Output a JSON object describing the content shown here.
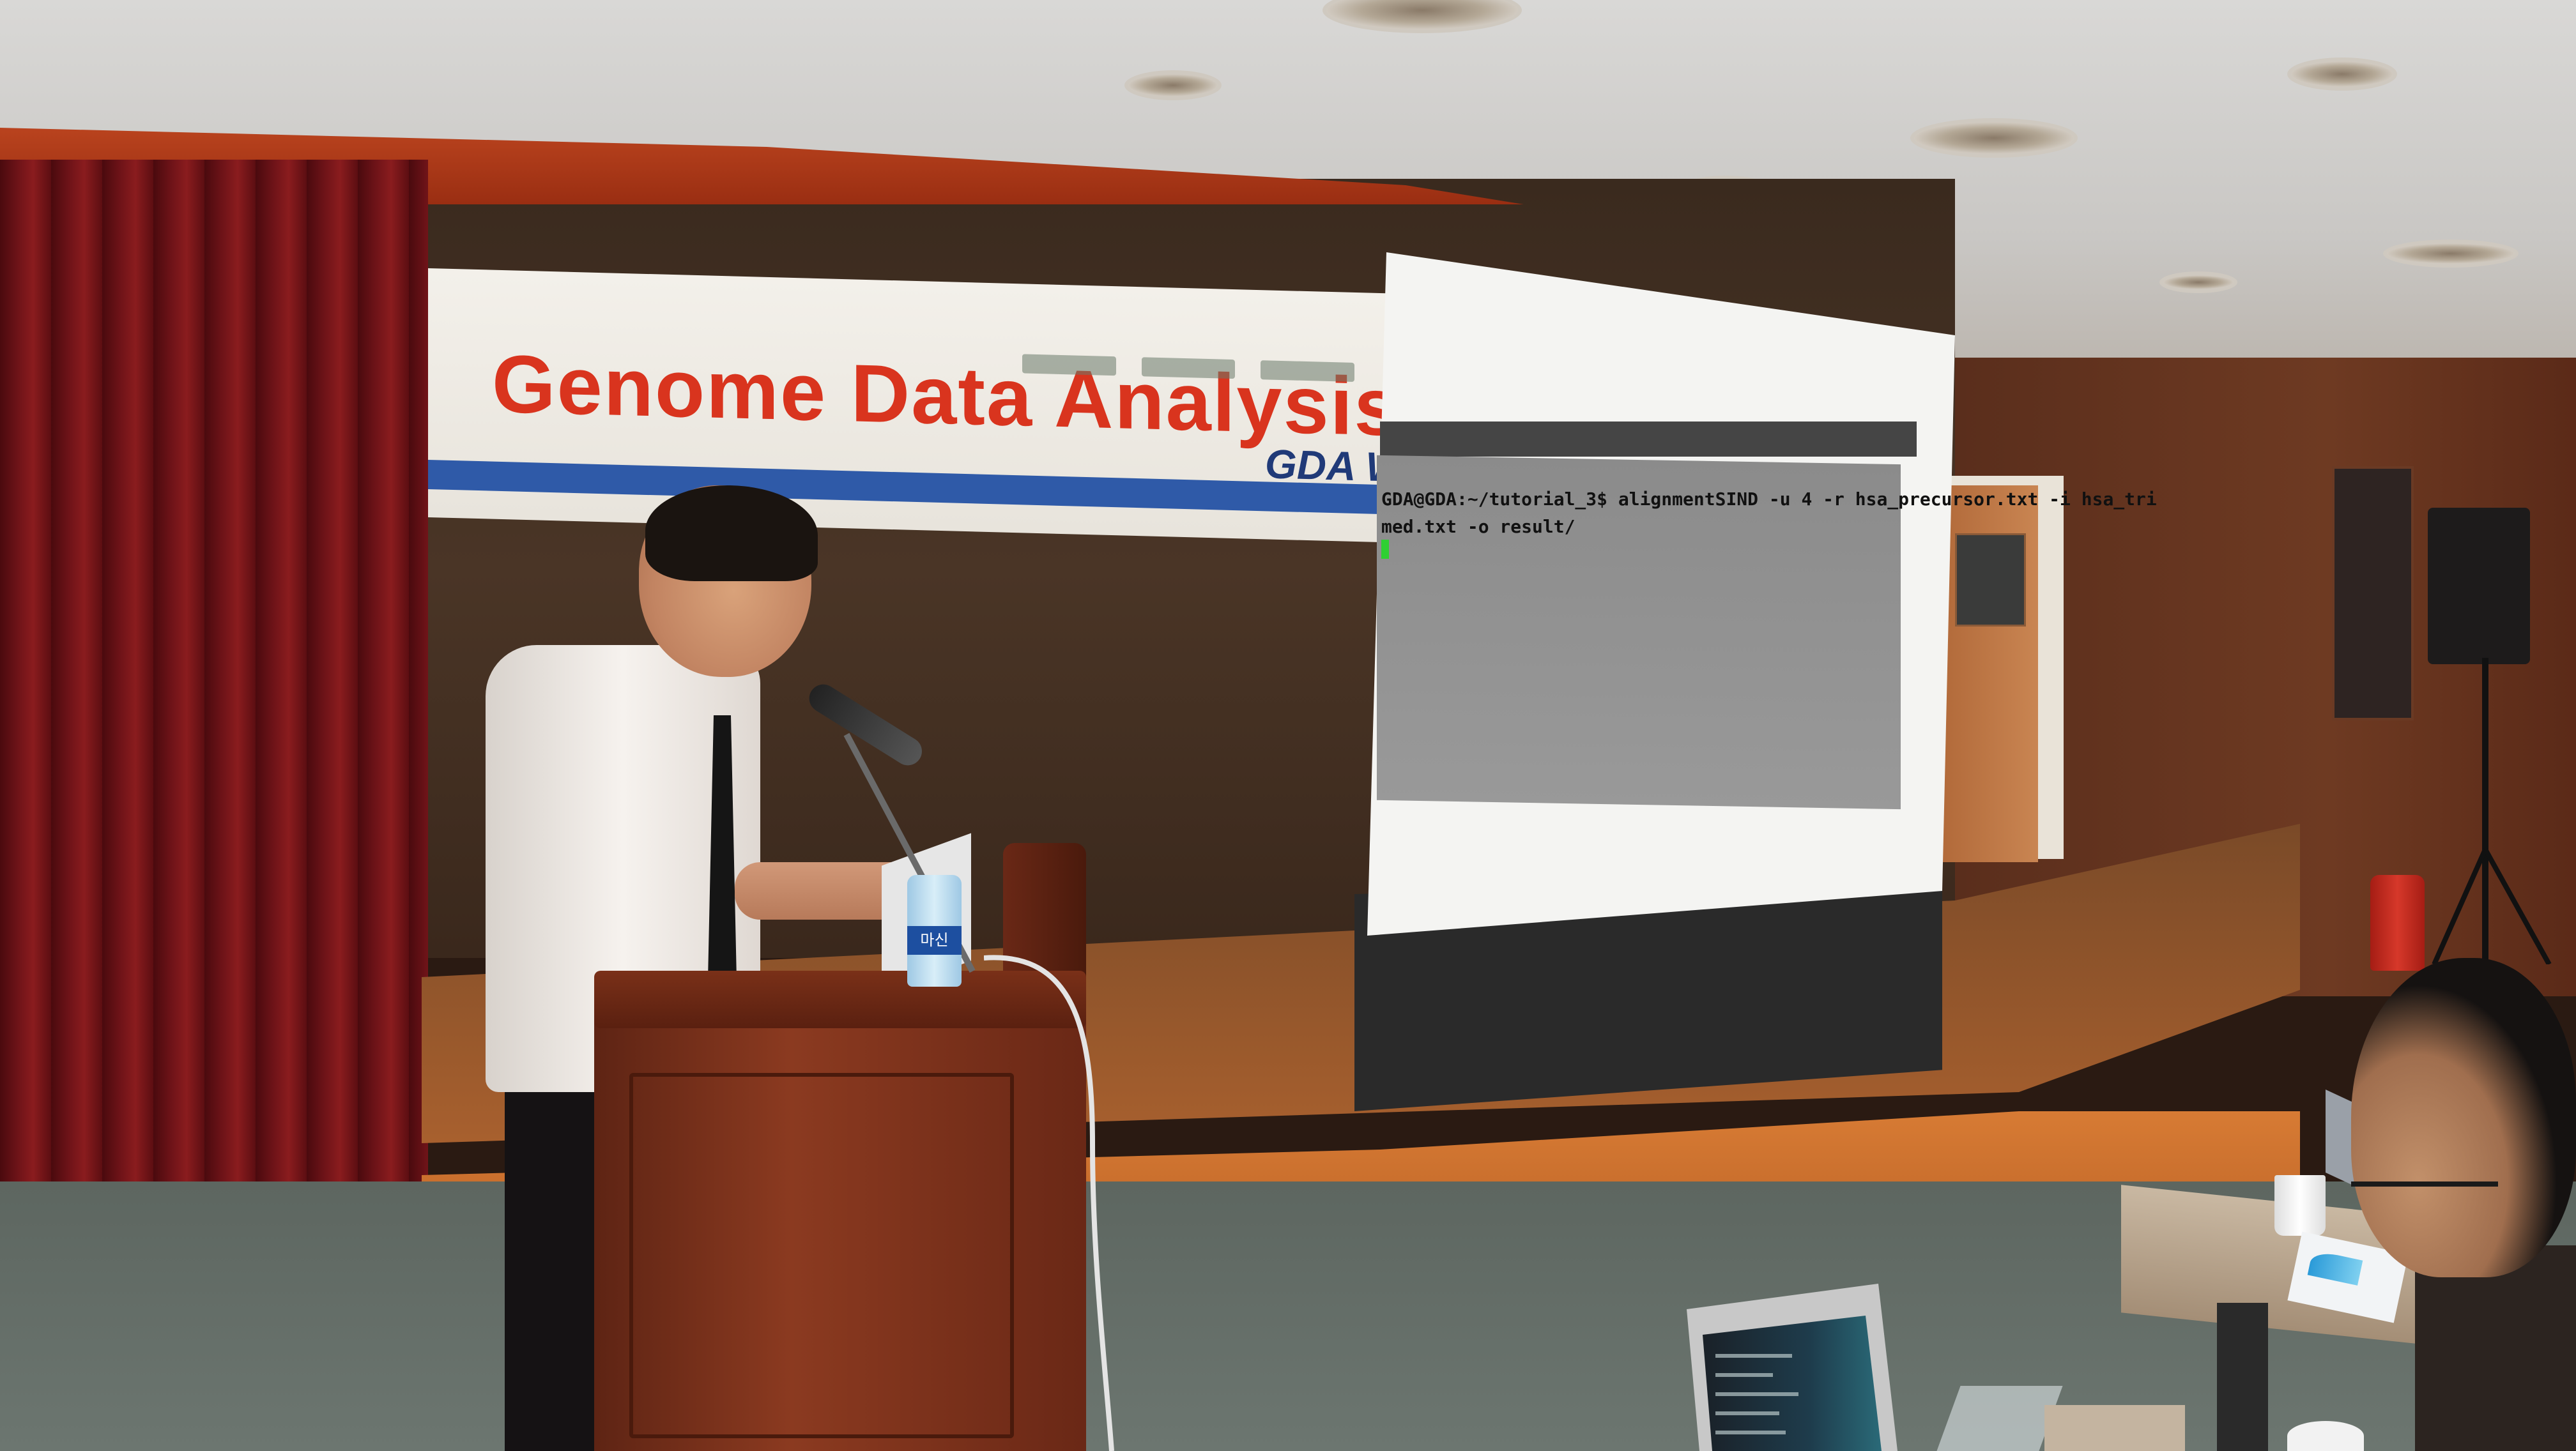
{
  "banner": {
    "title": "Genome Data Analysis",
    "subtitle": "GDA W"
  },
  "terminal": {
    "line1": "GDA@GDA:~/tutorial_3$ alignmentSIND -u 4 -r hsa_precursor.txt -i hsa_tri",
    "line2": "med.txt -o result/"
  },
  "bottle": {
    "label": "마신"
  },
  "colors": {
    "banner_title": "#d9341e",
    "banner_stripe": "#2f5aa8",
    "curtain": "#6e1318",
    "stage_edge": "#d77b34",
    "terminal_bg": "#8b8b8b",
    "cursor": "#2fd033"
  }
}
